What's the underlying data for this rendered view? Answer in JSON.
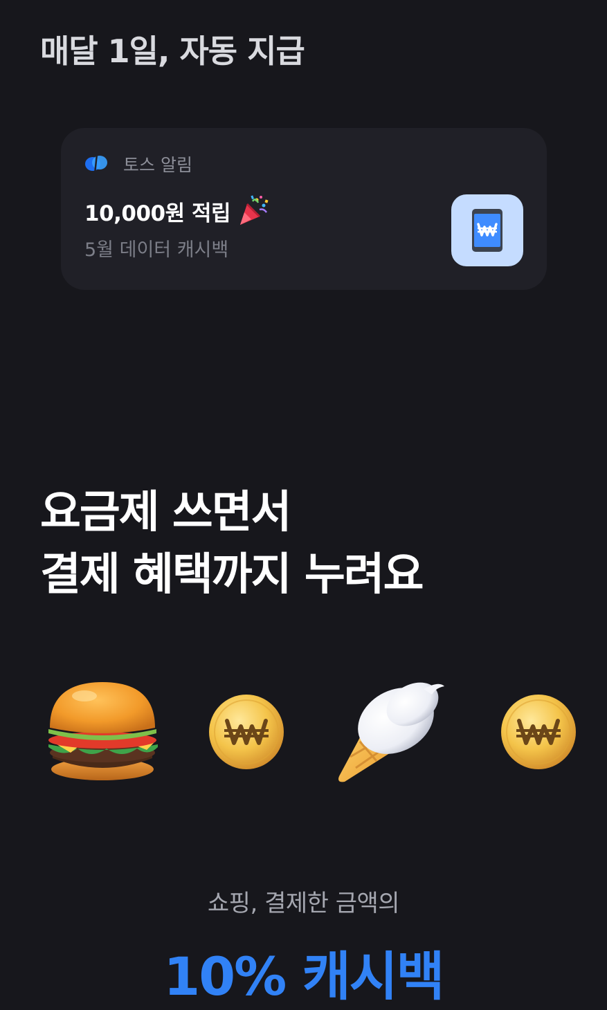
{
  "header": {
    "title": "매달 1일, 자동 지급"
  },
  "notification": {
    "app_name": "토스 알림",
    "title": "10,000원 적립",
    "subtitle": "5월 데이터 캐시백",
    "icons": {
      "app": "toss-logo-icon",
      "celebrate": "party-popper-icon",
      "thumbnail": "won-phone-icon"
    }
  },
  "headline": {
    "line1": "요금제 쓰면서",
    "line2": "결제 혜택까지 누려요"
  },
  "emoji_row": [
    "hamburger-icon",
    "won-coin-icon",
    "ice-cream-icon",
    "won-coin-icon"
  ],
  "benefit": {
    "subtitle": "쇼핑, 결제한 금액의",
    "highlight": "10% 캐시백"
  },
  "colors": {
    "background": "#17171c",
    "card": "#202027",
    "accent": "#3182f6",
    "thumbnail_bg": "#c5dcff"
  }
}
